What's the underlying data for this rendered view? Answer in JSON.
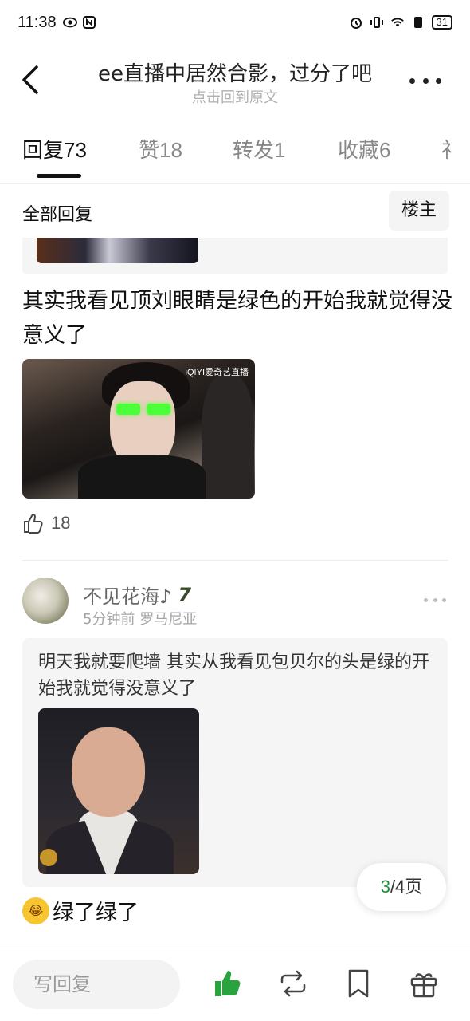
{
  "status_bar": {
    "time": "11:38",
    "battery": "31"
  },
  "nav": {
    "title": "ee直播中居然合影，过分了吧",
    "subtitle": "点击回到原文"
  },
  "tabs": [
    {
      "label": "回复",
      "count": "73"
    },
    {
      "label": "赞",
      "count": "18"
    },
    {
      "label": "转发",
      "count": "1"
    },
    {
      "label": "收藏",
      "count": "6"
    },
    {
      "label": "礼",
      "count": ""
    }
  ],
  "filter": {
    "label": "全部回复",
    "owner_button": "楼主"
  },
  "comment1": {
    "text": "其实我看见顶刘眼睛是绿色的开始我就觉得没意义了",
    "image_watermark": "iQIYI爱奇艺直播",
    "likes": "18"
  },
  "comment2": {
    "username": "不见花海♪",
    "level": "7",
    "time": "5分钟前",
    "location": "罗马尼亚",
    "quote_author": "明天我就要爬墙",
    "quote_text": "其实从我看见包贝尔的头是绿的开始我就觉得没意义了"
  },
  "comment3": {
    "text": "绿了绿了"
  },
  "pagination": {
    "current": "3",
    "total": "/4页"
  },
  "bottom_bar": {
    "reply_placeholder": "写回复"
  },
  "colors": {
    "accent_green": "#1f8f35"
  }
}
